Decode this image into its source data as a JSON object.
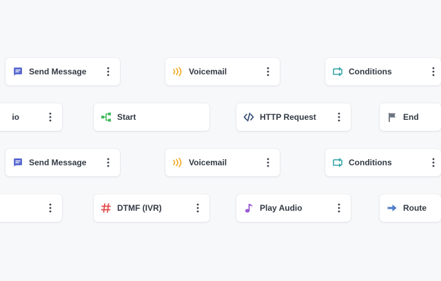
{
  "nodes": {
    "send_message_1": {
      "label": "Send Message",
      "icon": "message-icon",
      "color": "#5b6bd1"
    },
    "voicemail_1": {
      "label": "Voicemail",
      "icon": "voicemail-icon",
      "color": "#f2a81f"
    },
    "conditions_1": {
      "label": "Conditions",
      "icon": "conditions-icon",
      "color": "#3aa6a8"
    },
    "play_audio_partial": {
      "label": "io",
      "icon": "",
      "color": "#9a5bd6"
    },
    "start": {
      "label": "Start",
      "icon": "start-icon",
      "color": "#43b85c"
    },
    "http_request": {
      "label": "HTTP Request",
      "icon": "code-icon",
      "color": "#2f4a70"
    },
    "end": {
      "label": "End",
      "icon": "flag-icon",
      "color": "#6b7380"
    },
    "send_message_2": {
      "label": "Send Message",
      "icon": "message-icon",
      "color": "#5b6bd1"
    },
    "voicemail_2": {
      "label": "Voicemail",
      "icon": "voicemail-icon",
      "color": "#f2a81f"
    },
    "conditions_2": {
      "label": "Conditions",
      "icon": "conditions-icon",
      "color": "#3aa6a8"
    },
    "unknown_partial": {
      "label": "",
      "icon": "",
      "color": ""
    },
    "dtmf": {
      "label": "DTMF (IVR)",
      "icon": "hash-icon",
      "color": "#e04a4a"
    },
    "play_audio": {
      "label": "Play Audio",
      "icon": "music-note-icon",
      "color": "#9a5bd6"
    },
    "route": {
      "label": "Route",
      "icon": "arrow-right-icon",
      "color": "#4d7cc8"
    }
  },
  "menu_icon": "more-vertical-icon"
}
